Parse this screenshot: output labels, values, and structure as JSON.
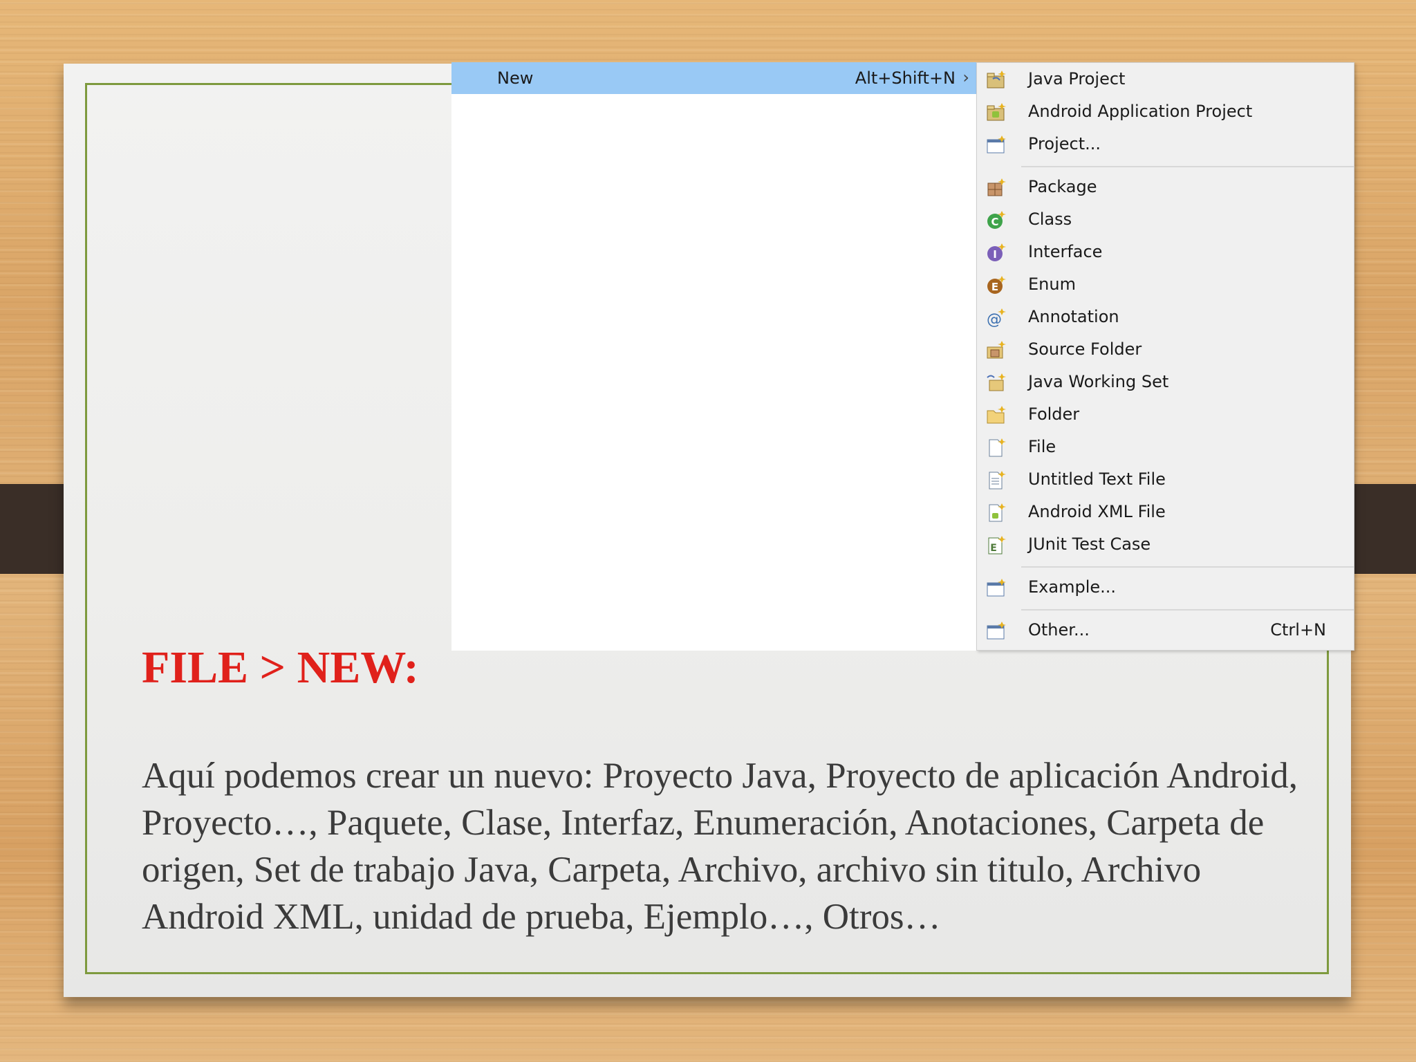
{
  "menu": {
    "new_item": {
      "label": "New",
      "shortcut": "Alt+Shift+N",
      "arrow": "›"
    },
    "submenu": [
      {
        "label": "Java Project",
        "icon": "java-project-icon",
        "shortcut": ""
      },
      {
        "label": "Android Application Project",
        "icon": "android-project-icon",
        "shortcut": ""
      },
      {
        "label": "Project...",
        "icon": "project-icon",
        "shortcut": ""
      },
      {
        "label": "Package",
        "icon": "package-icon",
        "shortcut": ""
      },
      {
        "label": "Class",
        "icon": "class-icon",
        "shortcut": ""
      },
      {
        "label": "Interface",
        "icon": "interface-icon",
        "shortcut": ""
      },
      {
        "label": "Enum",
        "icon": "enum-icon",
        "shortcut": ""
      },
      {
        "label": "Annotation",
        "icon": "annotation-icon",
        "shortcut": ""
      },
      {
        "label": "Source Folder",
        "icon": "source-folder-icon",
        "shortcut": ""
      },
      {
        "label": "Java Working Set",
        "icon": "working-set-icon",
        "shortcut": ""
      },
      {
        "label": "Folder",
        "icon": "folder-icon",
        "shortcut": ""
      },
      {
        "label": "File",
        "icon": "file-icon",
        "shortcut": ""
      },
      {
        "label": "Untitled Text File",
        "icon": "text-file-icon",
        "shortcut": ""
      },
      {
        "label": "Android XML File",
        "icon": "android-xml-icon",
        "shortcut": ""
      },
      {
        "label": "JUnit Test Case",
        "icon": "junit-icon",
        "shortcut": ""
      },
      {
        "label": "Example...",
        "icon": "example-icon",
        "shortcut": ""
      },
      {
        "label": "Other...",
        "icon": "other-icon",
        "shortcut": "Ctrl+N"
      }
    ]
  },
  "slide": {
    "heading": "FILE > NEW:",
    "body": "Aquí podemos crear un nuevo: Proyecto Java, Proyecto de aplicación Android, Proyecto…, Paquete, Clase, Interfaz, Enumeración, Anotaciones, Carpeta de origen, Set de trabajo Java, Carpeta, Archivo, archivo sin titulo, Archivo Android XML, unidad de prueba, Ejemplo…, Otros…"
  },
  "colors": {
    "heading": "#e0211b",
    "frame": "#7e9a3e",
    "highlight": "#99c9f5",
    "menu_bg": "#f0f0f0"
  }
}
